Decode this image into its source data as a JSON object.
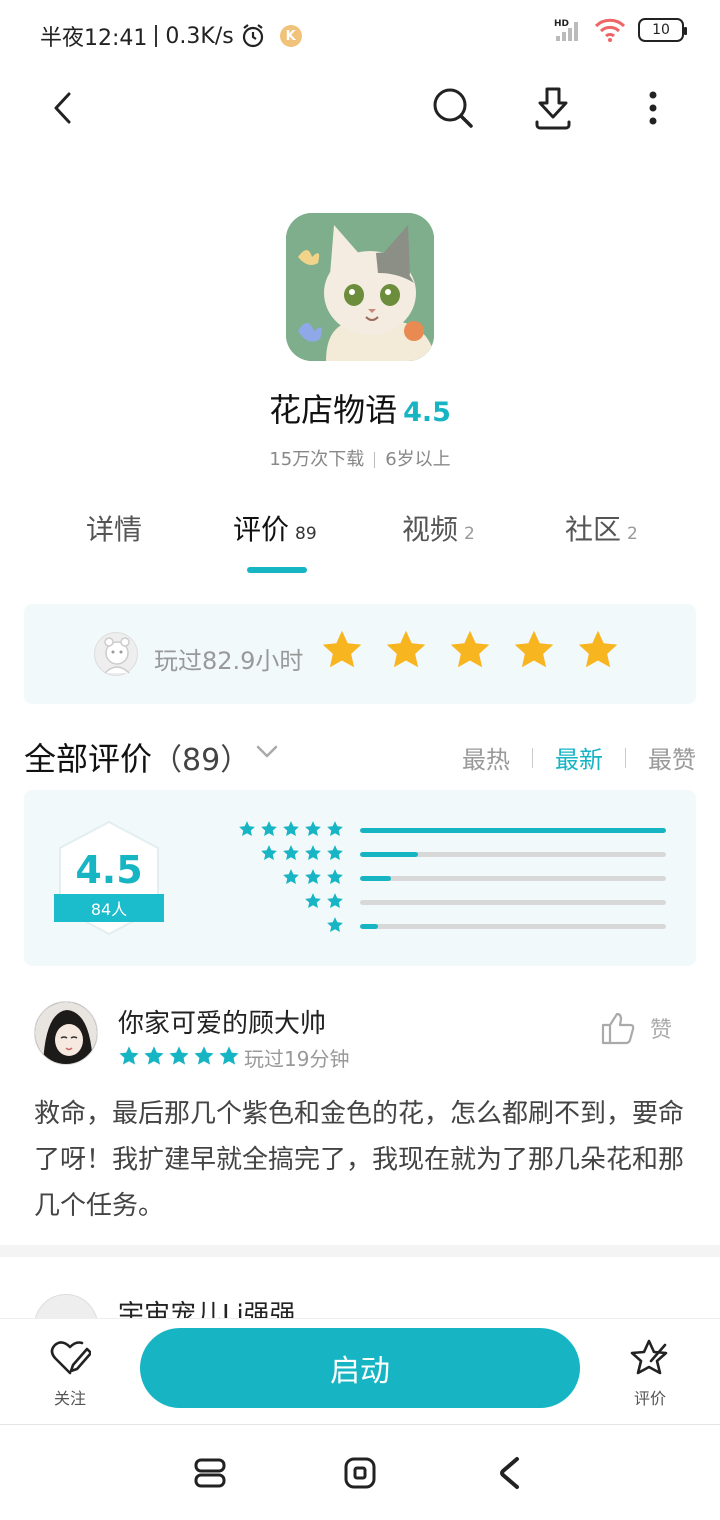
{
  "status_bar": {
    "time": "半夜12:41",
    "net_speed": "0.3K/s",
    "k_badge": "K",
    "hd": "HD",
    "battery": "10"
  },
  "app": {
    "name": "花店物语",
    "rating": "4.5",
    "downloads": "15万次下载",
    "age": "6岁以上"
  },
  "tabs": [
    {
      "label": "详情",
      "count": ""
    },
    {
      "label": "评价",
      "count": "89"
    },
    {
      "label": "视频",
      "count": "2"
    },
    {
      "label": "社区",
      "count": "2"
    }
  ],
  "played_box": {
    "text": "玩过82.9小时",
    "stars": 5
  },
  "reviews_section": {
    "title": "全部评价",
    "count": "（89）",
    "sort": [
      "最热",
      "最新",
      "最赞"
    ],
    "active_sort": "最新"
  },
  "summary": {
    "score": "4.5",
    "people": "84人",
    "distribution": [
      {
        "stars": 5,
        "fraction": 1.0
      },
      {
        "stars": 4,
        "fraction": 0.19
      },
      {
        "stars": 3,
        "fraction": 0.1
      },
      {
        "stars": 2,
        "fraction": 0.0
      },
      {
        "stars": 1,
        "fraction": 0.06
      }
    ]
  },
  "review1": {
    "name": "你家可爱的顾大帅",
    "stars": 5,
    "played": "玩过19分钟",
    "like_label": "赞",
    "text": "救命，最后那几个紫色和金色的花，怎么都刷不到，要命了呀！我扩建早就全搞完了，我现在就为了那几朵花和那几个任务。"
  },
  "review2": {
    "name": "宇宙宠儿Li强强"
  },
  "bottom_bar": {
    "follow": "关注",
    "launch": "启动",
    "rate": "评价"
  },
  "colors": {
    "accent": "#17b5c4",
    "star_gold": "#f7b51f"
  }
}
